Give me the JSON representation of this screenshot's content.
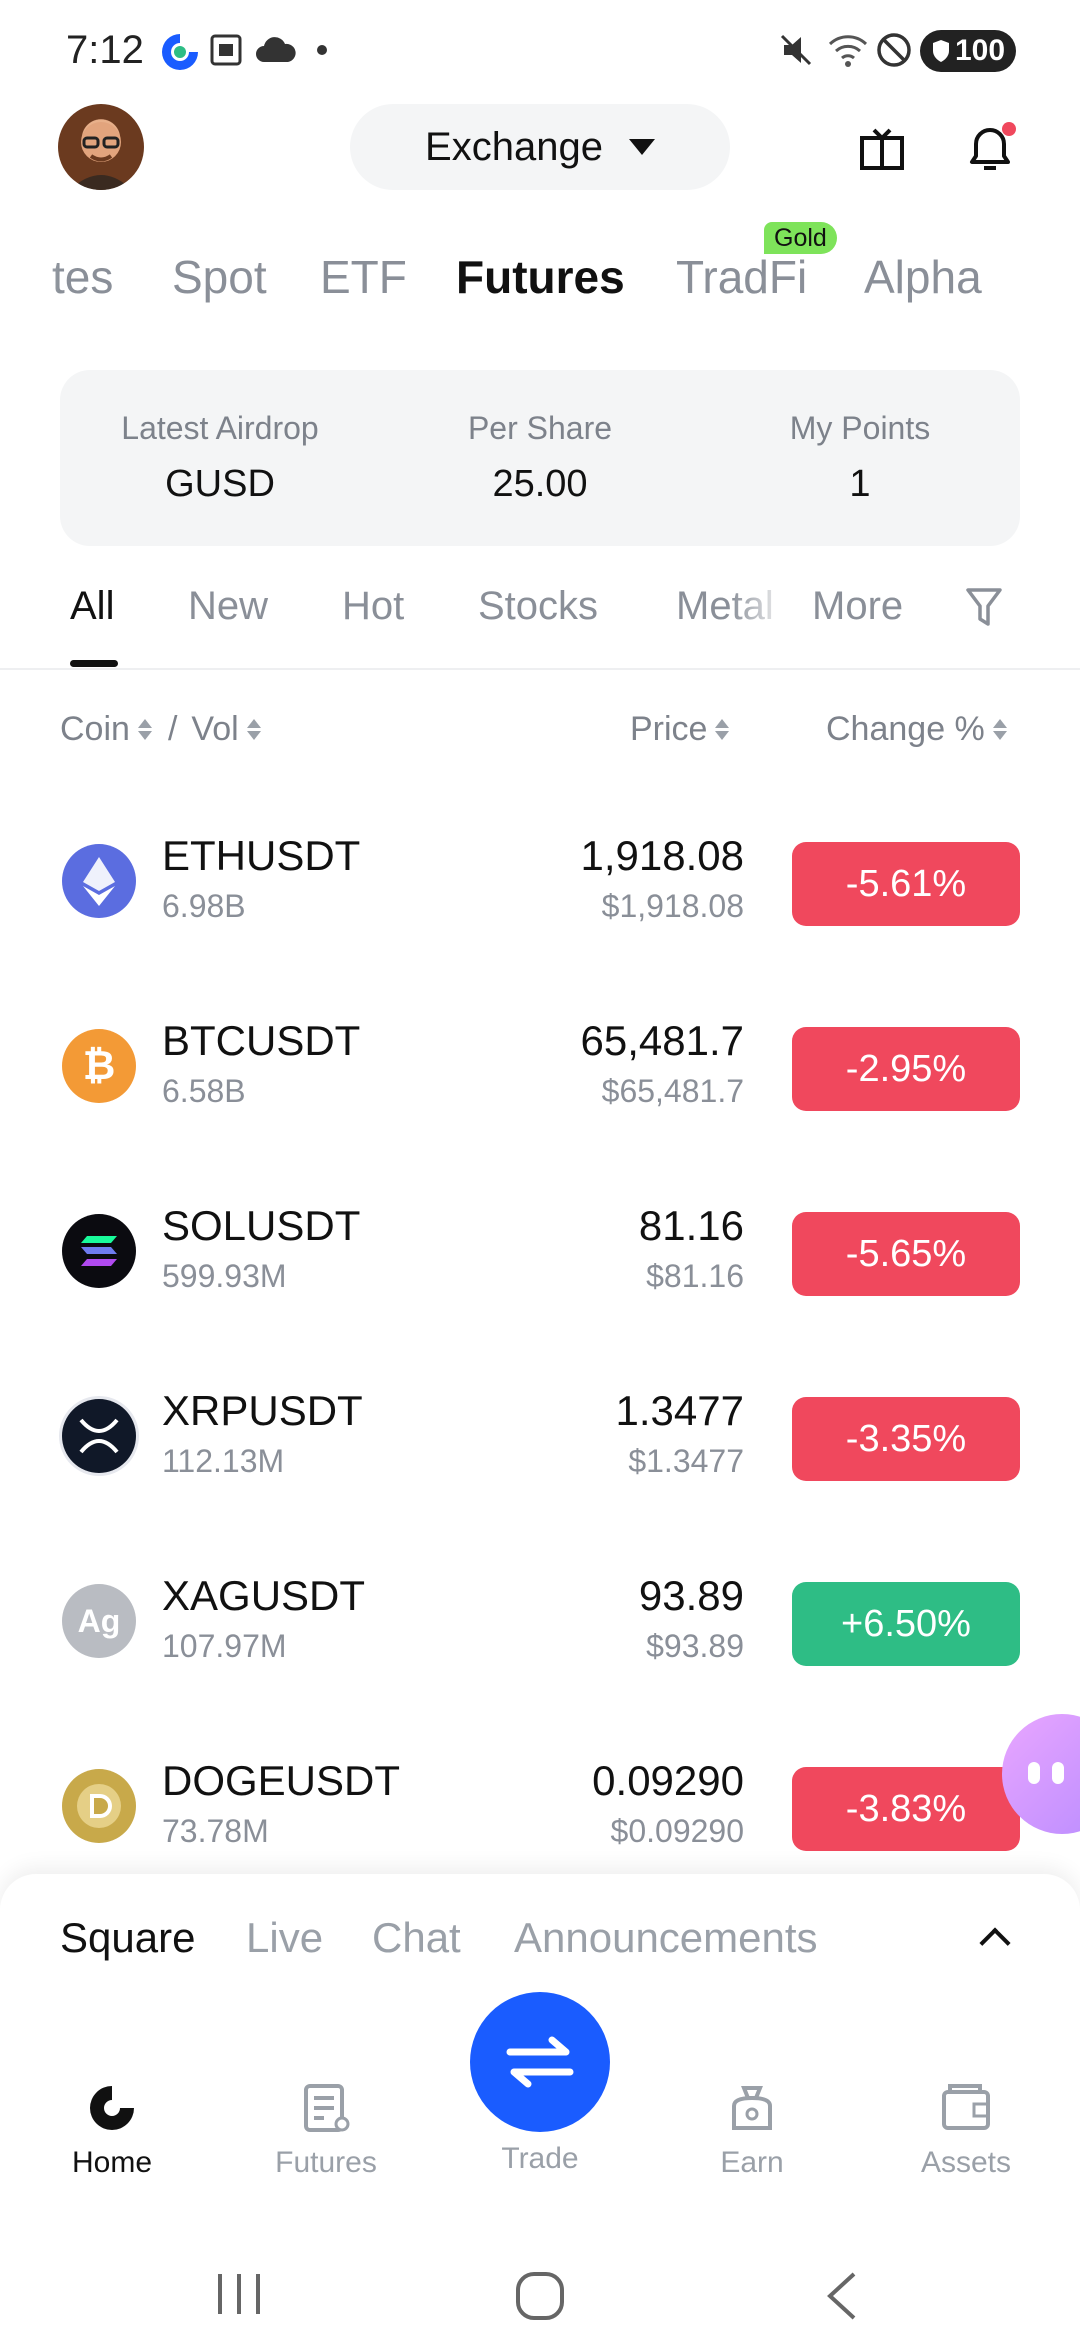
{
  "status_bar": {
    "time": "7:12",
    "battery": "100"
  },
  "header": {
    "exchange_label": "Exchange"
  },
  "top_tabs": [
    {
      "label": "tes"
    },
    {
      "label": "Spot"
    },
    {
      "label": "ETF"
    },
    {
      "label": "Futures"
    },
    {
      "label": "TradFi"
    },
    {
      "label": "Alpha"
    }
  ],
  "gold_badge": "Gold",
  "airdrop": {
    "latest_label": "Latest Airdrop",
    "latest_value": "GUSD",
    "share_label": "Per Share",
    "share_value": "25.00",
    "points_label": "My Points",
    "points_value": "1"
  },
  "filter_tabs": [
    {
      "label": "All"
    },
    {
      "label": "New"
    },
    {
      "label": "Hot"
    },
    {
      "label": "Stocks"
    },
    {
      "label": "Metal"
    },
    {
      "label": "More"
    }
  ],
  "columns": {
    "coin": "Coin",
    "sep": "/",
    "vol": "Vol",
    "price": "Price",
    "change": "Change %"
  },
  "rows": [
    {
      "symbol": "ETHUSDT",
      "volume": "6.98B",
      "price": "1,918.08",
      "fiat": "$1,918.08",
      "change": "-5.61%",
      "icon_name": "eth-icon",
      "color": "#5b6de0"
    },
    {
      "symbol": "BTCUSDT",
      "volume": "6.58B",
      "price": "65,481.7",
      "fiat": "$65,481.7",
      "change": "-2.95%",
      "icon_name": "btc-icon",
      "color": "#f39a36"
    },
    {
      "symbol": "SOLUSDT",
      "volume": "599.93M",
      "price": "81.16",
      "fiat": "$81.16",
      "change": "-5.65%",
      "icon_name": "sol-icon",
      "color": "#0b0b10"
    },
    {
      "symbol": "XRPUSDT",
      "volume": "112.13M",
      "price": "1.3477",
      "fiat": "$1.3477",
      "change": "-3.35%",
      "icon_name": "xrp-icon",
      "color": "#101828"
    },
    {
      "symbol": "XAGUSDT",
      "volume": "107.97M",
      "price": "93.89",
      "fiat": "$93.89",
      "change": "+6.50%",
      "icon_name": "silver-icon",
      "color": "#b9bcc2"
    },
    {
      "symbol": "DOGEUSDT",
      "volume": "73.78M",
      "price": "0.09290",
      "fiat": "$0.09290",
      "change": "-3.83%",
      "icon_name": "doge-icon",
      "color": "#c8a94a"
    }
  ],
  "sheet_tabs": [
    {
      "label": "Square"
    },
    {
      "label": "Live"
    },
    {
      "label": "Chat"
    },
    {
      "label": "Announcements"
    }
  ],
  "bottom_nav": {
    "home": "Home",
    "futures": "Futures",
    "trade": "Trade",
    "earn": "Earn",
    "assets": "Assets"
  },
  "colors": {
    "negative": "#f0485d",
    "positive": "#2ebd85",
    "accent": "#1a5cff",
    "badge": "#7ee35a"
  }
}
